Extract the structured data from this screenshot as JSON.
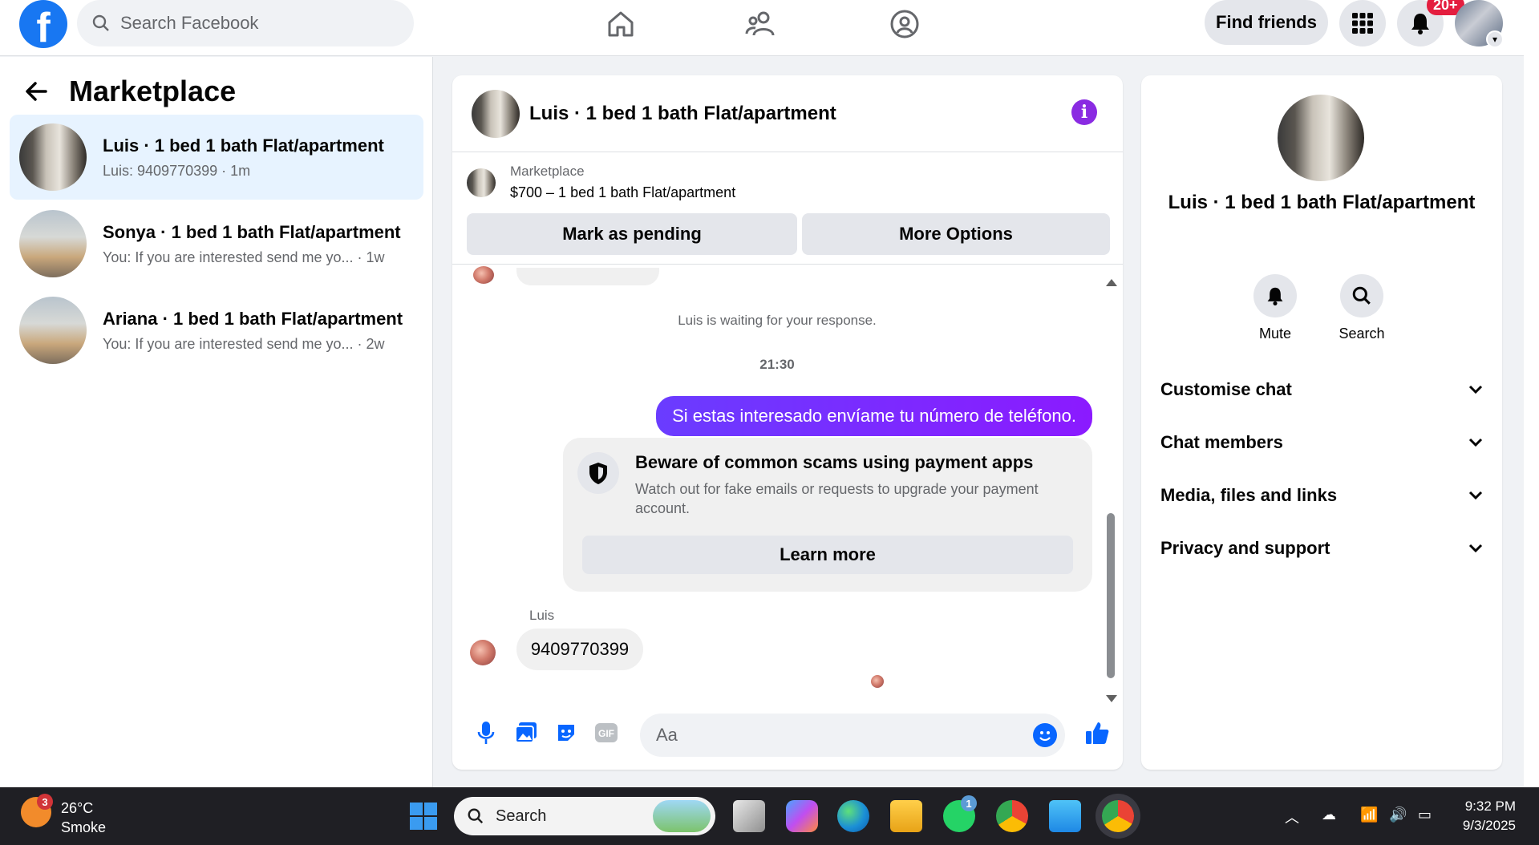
{
  "topbar": {
    "search_placeholder": "Search Facebook",
    "find_friends_label": "Find friends",
    "notifications_badge": "20+"
  },
  "sidebar": {
    "title": "Marketplace",
    "conversations": [
      {
        "name": "Luis · 1 bed 1 bath Flat/apartment",
        "preview": "Luis: 9409770399 · 1m",
        "active": true
      },
      {
        "name": "Sonya · 1 bed 1 bath Flat/apartment",
        "preview": "You: If you are interested send me yo... · 1w",
        "active": false
      },
      {
        "name": "Ariana · 1 bed 1 bath Flat/apartment",
        "preview": "You: If you are interested send me yo... · 2w",
        "active": false
      }
    ]
  },
  "chat": {
    "header_title": "Luis · 1 bed 1 bath Flat/apartment",
    "listing_label": "Marketplace",
    "listing_price": "$700 – 1 bed 1 bath Flat/apartment",
    "mark_pending_label": "Mark as pending",
    "more_options_label": "More Options",
    "waiting_text": "Luis is waiting for your response.",
    "timestamp": "21:30",
    "outgoing_message": "Si estas interesado envíame tu número de teléfono.",
    "scam_title": "Beware of common scams using payment apps",
    "scam_body": "Watch out for fake emails or requests to upgrade your payment account.",
    "learn_more_label": "Learn more",
    "sender_name": "Luis",
    "incoming_message": "9409770399",
    "composer_placeholder": "Aa"
  },
  "details": {
    "title": "Luis · 1 bed 1 bath Flat/apartment",
    "mute_label": "Mute",
    "search_label": "Search",
    "sections": [
      "Customise chat",
      "Chat members",
      "Media, files and links",
      "Privacy and support"
    ]
  },
  "taskbar": {
    "weather_badge": "3",
    "temperature": "26°C",
    "condition": "Smoke",
    "search_placeholder": "Search",
    "whatsapp_badge": "1",
    "time": "9:32 PM",
    "date": "9/3/2025"
  },
  "colors": {
    "facebook_blue": "#1877f2",
    "messenger_purple": "#7a1fff",
    "notification_red": "#e41e3f"
  }
}
